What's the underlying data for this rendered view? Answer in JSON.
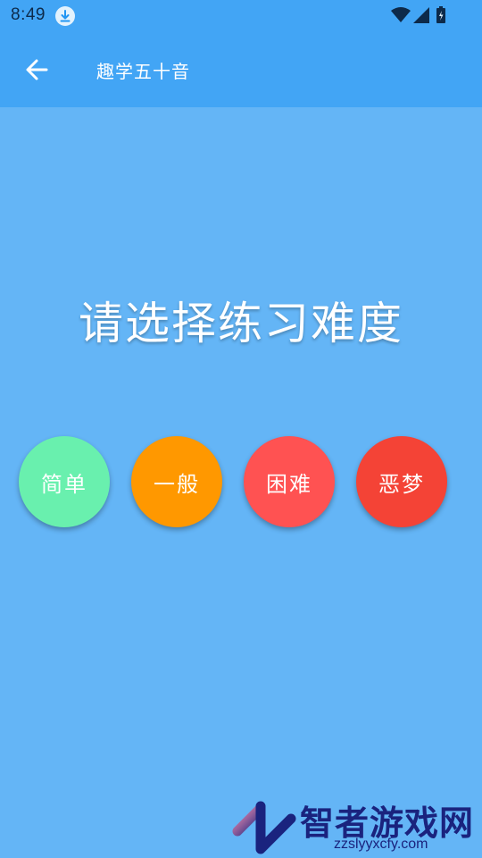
{
  "status_bar": {
    "time": "8:49",
    "icons": [
      "download-icon",
      "wifi-icon",
      "signal-icon",
      "battery-icon"
    ]
  },
  "app_bar": {
    "title": "趣学五十音",
    "back_icon": "arrow-back-icon"
  },
  "main": {
    "prompt": "请选择练习难度",
    "levels": [
      {
        "label": "简单",
        "color": "#69f0ae"
      },
      {
        "label": "一般",
        "color": "#ff9800"
      },
      {
        "label": "困难",
        "color": "#ff5252"
      },
      {
        "label": "恶梦",
        "color": "#f44336"
      }
    ]
  },
  "watermark": {
    "name": "智者游戏网",
    "url": "zzslyyxcfy.com"
  },
  "colors": {
    "background": "#64b5f6",
    "app_bar": "#42a5f5"
  }
}
